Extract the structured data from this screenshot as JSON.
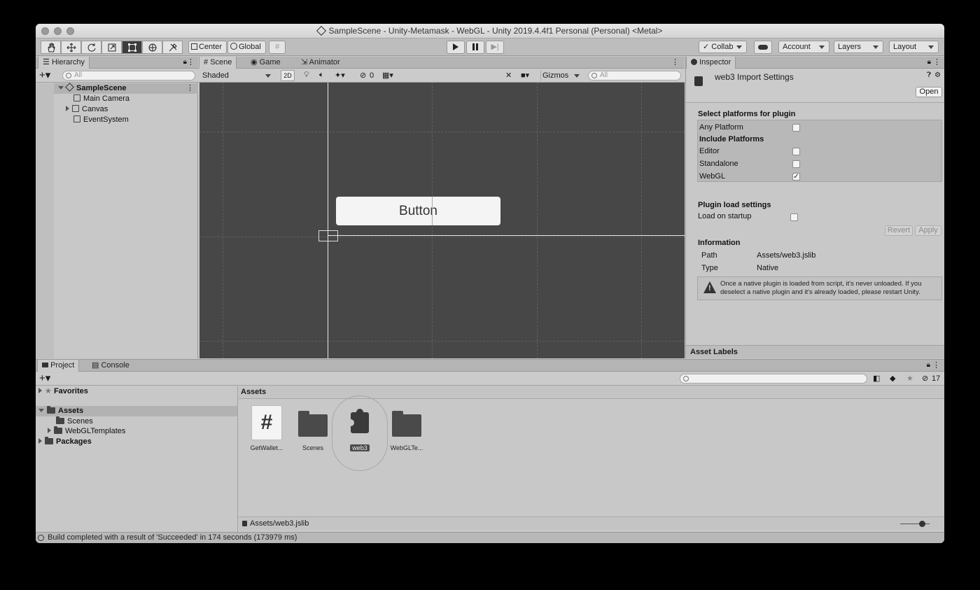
{
  "window": {
    "title": "SampleScene - Unity-Metamask - WebGL - Unity 2019.4.4f1 Personal (Personal) <Metal>"
  },
  "toolbar": {
    "tools": [
      "hand-icon",
      "move-icon",
      "rotate-icon",
      "scale-icon",
      "rect-icon",
      "transform-icon",
      "custom-tool-icon"
    ],
    "pivot_label": "Center",
    "space_label": "Global",
    "collab_label": "Collab",
    "account_label": "Account",
    "layers_label": "Layers",
    "layout_label": "Layout"
  },
  "hierarchy": {
    "tab_label": "Hierarchy",
    "search_placeholder": "All",
    "scene_name": "SampleScene",
    "items": [
      {
        "label": "Main Camera"
      },
      {
        "label": "Canvas"
      },
      {
        "label": "EventSystem"
      }
    ]
  },
  "scene_panel": {
    "tabs": [
      {
        "label": "Scene"
      },
      {
        "label": "Game"
      },
      {
        "label": "Animator"
      }
    ],
    "shading_mode": "Shaded",
    "mode_2d": "2D",
    "hidden_count": "0",
    "gizmos_label": "Gizmos",
    "search_placeholder": "All",
    "button_label": "Button"
  },
  "inspector": {
    "tab_label": "Inspector",
    "asset_title": "web3 Import Settings",
    "open_label": "Open",
    "select_platforms_heading": "Select platforms for plugin",
    "any_platform_label": "Any Platform",
    "include_platforms_heading": "Include Platforms",
    "platforms": [
      {
        "label": "Editor",
        "checked": false
      },
      {
        "label": "Standalone",
        "checked": false
      },
      {
        "label": "WebGL",
        "checked": true
      }
    ],
    "load_settings_heading": "Plugin load settings",
    "load_on_startup_label": "Load on startup",
    "revert_label": "Revert",
    "apply_label": "Apply",
    "information_heading": "Information",
    "path_label": "Path",
    "path_value": "Assets/web3.jslib",
    "type_label": "Type",
    "type_value": "Native",
    "warning_text": "Once a native plugin is loaded from script, it's never unloaded. If you deselect a native plugin and it's already loaded, please restart Unity.",
    "asset_labels_heading": "Asset Labels"
  },
  "project": {
    "tabs": [
      {
        "label": "Project"
      },
      {
        "label": "Console"
      }
    ],
    "hidden_count": "17",
    "favorites_label": "Favorites",
    "assets_label": "Assets",
    "tree": [
      {
        "label": "Scenes"
      },
      {
        "label": "WebGLTemplates"
      }
    ],
    "packages_label": "Packages",
    "breadcrumb": "Assets",
    "assets": [
      {
        "label": "GetWallet...",
        "icon": "script-icon"
      },
      {
        "label": "Scenes",
        "icon": "folder-icon"
      },
      {
        "label": "web3",
        "icon": "plugin-icon"
      },
      {
        "label": "WebGLTe...",
        "icon": "folder-icon"
      }
    ],
    "selected_path": "Assets/web3.jslib"
  },
  "status_bar": {
    "message": "Build completed with a result of 'Succeeded' in 174 seconds (173979 ms)"
  }
}
